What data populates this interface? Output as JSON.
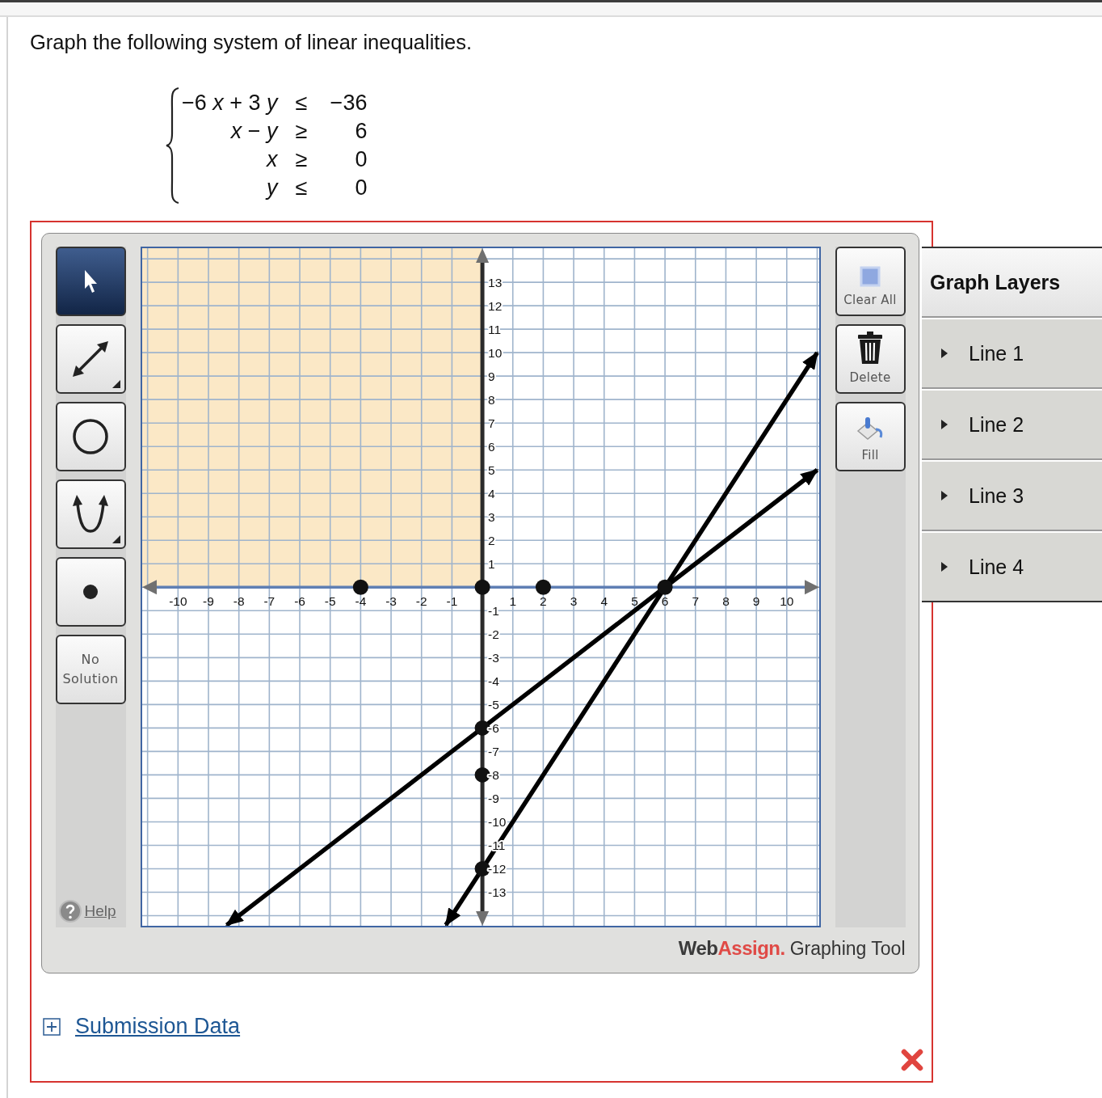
{
  "question": {
    "prompt": "Graph the following system of linear inequalities.",
    "system": [
      {
        "lhs": "−6 *x* + 3 *y*",
        "relation": "≤",
        "rhs": "−36"
      },
      {
        "lhs": "*x* − *y*",
        "relation": "≥",
        "rhs": "6"
      },
      {
        "lhs": "*x*",
        "relation": "≥",
        "rhs": "0"
      },
      {
        "lhs": "*y*",
        "relation": "≤",
        "rhs": "0"
      }
    ]
  },
  "graphing_tool": {
    "tools": [
      {
        "kind": "pointer",
        "selected": true
      },
      {
        "kind": "line",
        "selected": false
      },
      {
        "kind": "circle",
        "selected": false
      },
      {
        "kind": "parabola",
        "selected": false
      },
      {
        "kind": "point",
        "selected": false
      },
      {
        "kind": "no_solution",
        "label": "No Solution",
        "selected": false
      }
    ],
    "help_link": "Help",
    "graph": {
      "shading": {
        "kind": "upper_left_quadrant"
      },
      "chart_data": {
        "type": "line",
        "grid": true,
        "xlim": [
          -11.23,
          11.12
        ],
        "ylim": [
          -14.5,
          14.52
        ],
        "xticks": [
          {
            "value": -10,
            "label": "-10"
          },
          {
            "value": -9,
            "label": "-9"
          },
          {
            "value": -8,
            "label": "-8"
          },
          {
            "value": -7,
            "label": "-7"
          },
          {
            "value": -6,
            "label": "-6"
          },
          {
            "value": -5,
            "label": "-5"
          },
          {
            "value": -4,
            "label": "-4"
          },
          {
            "value": -3,
            "label": "-3"
          },
          {
            "value": -2,
            "label": "-2"
          },
          {
            "value": -1,
            "label": "-1"
          },
          {
            "value": 1,
            "label": "1"
          },
          {
            "value": 2,
            "label": "2"
          },
          {
            "value": 3,
            "label": "3"
          },
          {
            "value": 4,
            "label": "4"
          },
          {
            "value": 5,
            "label": "5"
          },
          {
            "value": 6,
            "label": "6"
          },
          {
            "value": 7,
            "label": "7"
          },
          {
            "value": 8,
            "label": "8"
          },
          {
            "value": 9,
            "label": "9"
          },
          {
            "value": 10,
            "label": "10"
          }
        ],
        "yticks": [
          {
            "value": -13,
            "label": "-13"
          },
          {
            "value": -12,
            "label": "-12"
          },
          {
            "value": -11,
            "label": "-11"
          },
          {
            "value": -10,
            "label": "-10"
          },
          {
            "value": -9,
            "label": "-9"
          },
          {
            "value": -8,
            "label": "-8"
          },
          {
            "value": -7,
            "label": "-7"
          },
          {
            "value": -6,
            "label": "-6"
          },
          {
            "value": -5,
            "label": "-5"
          },
          {
            "value": -4,
            "label": "-4"
          },
          {
            "value": -3,
            "label": "-3"
          },
          {
            "value": -2,
            "label": "-2"
          },
          {
            "value": -1,
            "label": "-1"
          },
          {
            "value": 1,
            "label": "1"
          },
          {
            "value": 2,
            "label": "2"
          },
          {
            "value": 3,
            "label": "3"
          },
          {
            "value": 4,
            "label": "4"
          },
          {
            "value": 5,
            "label": "5"
          },
          {
            "value": 6,
            "label": "6"
          },
          {
            "value": 7,
            "label": "7"
          },
          {
            "value": 8,
            "label": "8"
          },
          {
            "value": 9,
            "label": "9"
          },
          {
            "value": 10,
            "label": "10"
          },
          {
            "value": 11,
            "label": "11"
          },
          {
            "value": 12,
            "label": "12"
          },
          {
            "value": 13,
            "label": "13"
          }
        ],
        "x": [
          -8.4,
          -4,
          -1.2,
          0,
          0,
          0,
          0,
          2,
          6,
          11
        ],
        "series": [
          {
            "color": "#000000",
            "values": [
              null,
              null,
              -14.4,
              -12,
              -12,
              -12,
              -12,
              -8,
              0,
              10
            ]
          },
          {
            "color": "#000000",
            "values": [
              -14.4,
              -10,
              -7.2,
              -6,
              -6,
              -6,
              -6,
              -4,
              0,
              5
            ]
          },
          {
            "type": "scatter",
            "color": "#111111",
            "values": [
              null,
              0,
              null,
              0,
              -6,
              -8,
              -12,
              0,
              0,
              null
            ]
          }
        ]
      }
    },
    "actions": [
      {
        "kind": "clear",
        "label": "Clear All"
      },
      {
        "kind": "delete",
        "label": "Delete"
      },
      {
        "kind": "fill",
        "label": "Fill"
      }
    ],
    "layers": {
      "title": "Graph Layers",
      "items": [
        {
          "label": "Line 1",
          "expanded": false
        },
        {
          "label": "Line 2",
          "expanded": false
        },
        {
          "label": "Line 3",
          "expanded": false
        },
        {
          "label": "Line 4",
          "expanded": false
        }
      ]
    },
    "brand": {
      "logo": [
        "Web",
        "Assign."
      ],
      "caption": "Graphing Tool"
    }
  },
  "submission_link": "Submission Data",
  "result": {
    "kind": "incorrect"
  }
}
